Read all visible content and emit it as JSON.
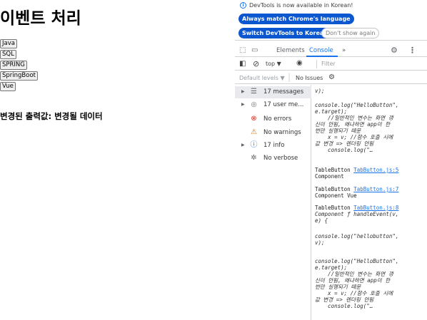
{
  "page": {
    "title": "이벤트 처리",
    "buttons": [
      "Java",
      "SQL",
      "SPRING",
      "SpringBoot",
      "Vue"
    ],
    "result": "변경된 출력값: 변경될 데이터"
  },
  "devtools": {
    "info": "DevTools is now available in Korean!",
    "btn_match": "Always match Chrome's language",
    "btn_switch": "Switch DevTools to Korean",
    "btn_dont_show": "Don't show again",
    "tabs": {
      "elements": "Elements",
      "console": "Console",
      "more": "»"
    },
    "toolbar": {
      "context": "top ▼",
      "filter_placeholder": "Filter"
    },
    "levels": {
      "label": "Default levels ▼",
      "issues": "No Issues"
    },
    "sidebar": [
      {
        "label": "17 messages",
        "icon": "list-icon",
        "glyph": "☰",
        "color": "#5f6368",
        "arrow": "▶"
      },
      {
        "label": "17 user me...",
        "icon": "user-icon",
        "glyph": "👤",
        "color": "#5f6368",
        "arrow": "▶"
      },
      {
        "label": "No errors",
        "icon": "error-icon",
        "glyph": "⊗",
        "color": "#d93025",
        "arrow": ""
      },
      {
        "label": "No warnings",
        "icon": "warning-icon",
        "glyph": "⚠",
        "color": "#e37400",
        "arrow": ""
      },
      {
        "label": "17 info",
        "icon": "info-icon",
        "glyph": "ⓘ",
        "color": "#1a73e8",
        "arrow": "▶"
      },
      {
        "label": "No verbose",
        "icon": "bug-icon",
        "glyph": "✲",
        "color": "#5f6368",
        "arrow": ""
      }
    ],
    "console_lines": {
      "c1": "v);",
      "c2": "console.log(\"HelloButton\",\ne.target);\n    //일반적인 변수는 화면 갱\n신이 안됨, 왜냐하면 app이 한\n번만 실행되기 때문\n    x = v; //함수 호출 시에\n값 변경 => 렌더링 안됨\n    console.log(\"…",
      "l1a": "TableButton ",
      "l1src": "TabButton.js:5",
      "l1b": "Component",
      "l2a": "TableButton ",
      "l2src": "TabButton.js:7",
      "l2b": "Component Vue",
      "l3a": "TableButton ",
      "l3src": "TabButton.js:8",
      "l3b": "Component ƒ handleEvent(v,\ne) {",
      "c3": "console.log(\"hellobutton\",\nv);",
      "c4": "console.log(\"HelloButton\",\ne.target);\n    //일반적인 변수는 화면 갱\n신이 안됨, 왜냐하면 app이 한\n번만 실행되기 때문\n    x = v; //함수 호출 시에\n값 변경 => 렌더링 안됨\n    console.log(\"…"
    }
  },
  "colors": {
    "accent": "#1a73e8",
    "pill": "#0b57d0",
    "error": "#d93025",
    "warning": "#e37400"
  }
}
